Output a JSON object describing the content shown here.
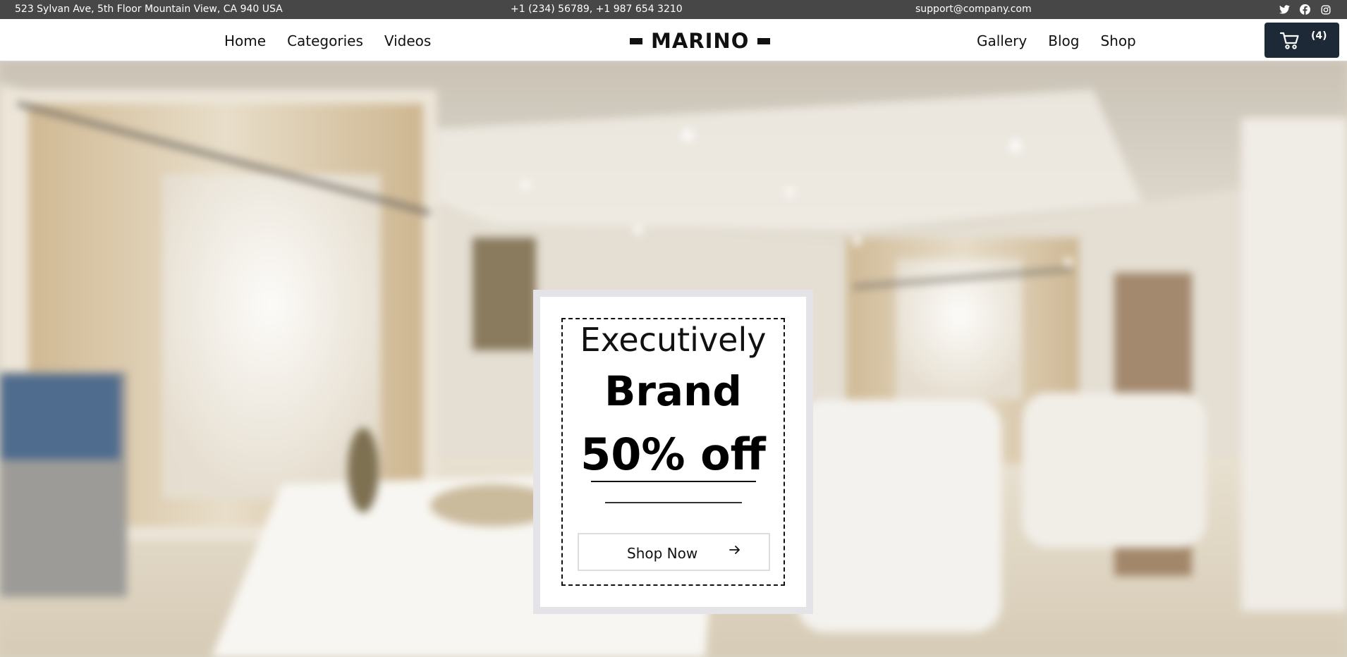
{
  "topbar": {
    "address": "523 Sylvan Ave, 5th Floor Mountain View, CA 940 USA",
    "phones": "+1 (234) 56789, +1 987 654 3210",
    "email": "support@company.com",
    "socials": [
      "twitter-icon",
      "facebook-icon",
      "instagram-icon"
    ]
  },
  "nav": {
    "left": [
      {
        "label": "Home"
      },
      {
        "label": "Categories"
      },
      {
        "label": "Videos"
      }
    ],
    "right": [
      {
        "label": "Gallery"
      },
      {
        "label": "Blog"
      },
      {
        "label": "Shop"
      }
    ],
    "logo": "MARINO",
    "cart": {
      "count": "(4)",
      "icon": "cart-icon"
    }
  },
  "hero": {
    "promo": {
      "line1": "Executively",
      "line2": "Brand",
      "line3": "50% off",
      "button": "Shop Now"
    }
  },
  "colors": {
    "topbar_bg": "#474747",
    "cart_bg": "#1e2937",
    "promo_border": "#e3e3e8"
  }
}
